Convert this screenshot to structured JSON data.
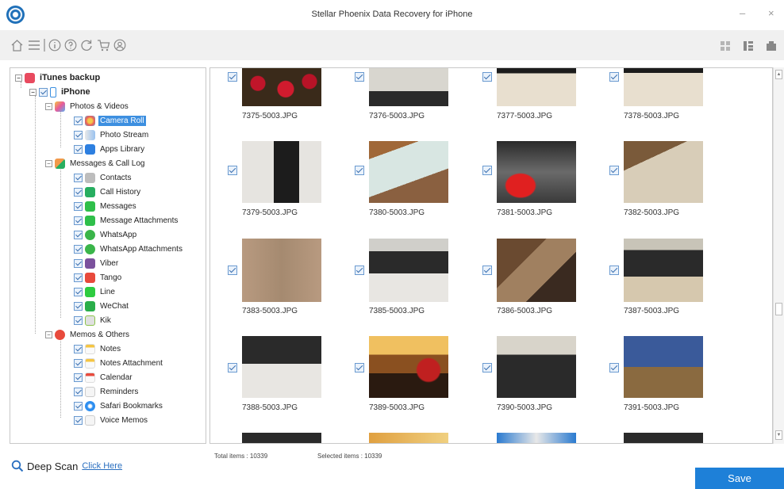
{
  "window": {
    "title": "Stellar Phoenix Data Recovery for iPhone",
    "minimize": "–",
    "close": "×"
  },
  "toolbar": {
    "icons": [
      "home-icon",
      "menu-icon",
      "info-icon",
      "help-icon",
      "refresh-icon",
      "cart-icon",
      "user-icon"
    ],
    "view_icons": [
      "grid-view-icon",
      "list-view-icon",
      "detail-view-icon"
    ]
  },
  "tree": {
    "root": "iTunes backup",
    "device": "iPhone",
    "groups": [
      {
        "label": "Photos & Videos",
        "items": [
          "Camera Roll",
          "Photo Stream",
          "Apps Library"
        ]
      },
      {
        "label": "Messages & Call Log",
        "items": [
          "Contacts",
          "Call History",
          "Messages",
          "Message Attachments",
          "WhatsApp",
          "WhatsApp Attachments",
          "Viber",
          "Tango",
          "Line",
          "WeChat",
          "Kik"
        ]
      },
      {
        "label": "Memos & Others",
        "items": [
          "Notes",
          "Notes Attachment",
          "Calendar",
          "Reminders",
          "Safari Bookmarks",
          "Voice Memos"
        ]
      }
    ],
    "selected": "Camera Roll"
  },
  "grid": {
    "rows": [
      [
        "7375-5003.JPG",
        "7376-5003.JPG",
        "7377-5003.JPG",
        "7378-5003.JPG"
      ],
      [
        "7379-5003.JPG",
        "7380-5003.JPG",
        "7381-5003.JPG",
        "7382-5003.JPG"
      ],
      [
        "7383-5003.JPG",
        "7385-5003.JPG",
        "7386-5003.JPG",
        "7387-5003.JPG"
      ],
      [
        "7388-5003.JPG",
        "7389-5003.JPG",
        "7390-5003.JPG",
        "7391-5003.JPG"
      ]
    ]
  },
  "footer": {
    "total_items": "Total items : 10339",
    "selected_items": "Selected items : 10339",
    "deep_scan_label": "Deep Scan",
    "deep_scan_link": "Click Here",
    "save_label": "Save"
  },
  "colors": {
    "accent": "#1e80d8",
    "selection": "#3d8fe0",
    "toolbar_bg": "#f0f0f0"
  }
}
